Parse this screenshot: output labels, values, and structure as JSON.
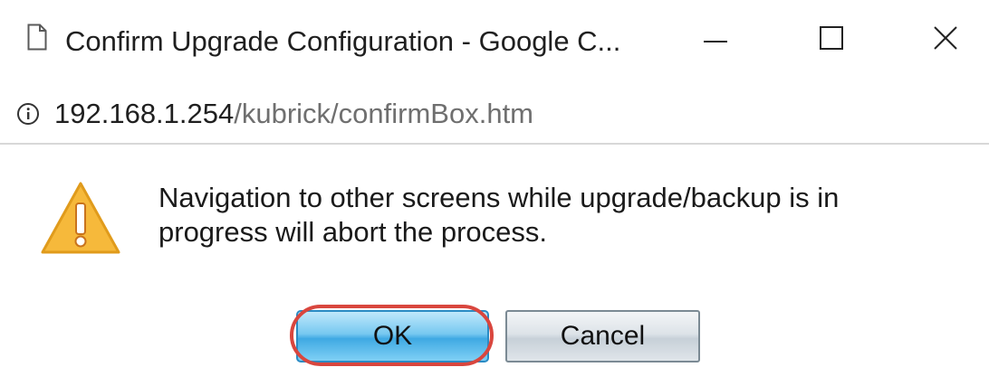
{
  "window": {
    "title": "Confirm Upgrade Configuration - Google C..."
  },
  "address": {
    "host": "192.168.1.254",
    "path": "/kubrick/confirmBox.htm"
  },
  "dialog": {
    "message": "Navigation to other screens while upgrade/backup is in progress will abort the process.",
    "ok_label": "OK",
    "cancel_label": "Cancel"
  },
  "icons": {
    "page": "page-icon",
    "info": "info-icon",
    "warning": "warning-icon",
    "minimize": "minimize-icon",
    "maximize": "maximize-icon",
    "close": "close-icon"
  },
  "colors": {
    "warning_fill": "#f6b93b",
    "ok_button": "#4db3e8",
    "highlight": "#d9463e"
  }
}
